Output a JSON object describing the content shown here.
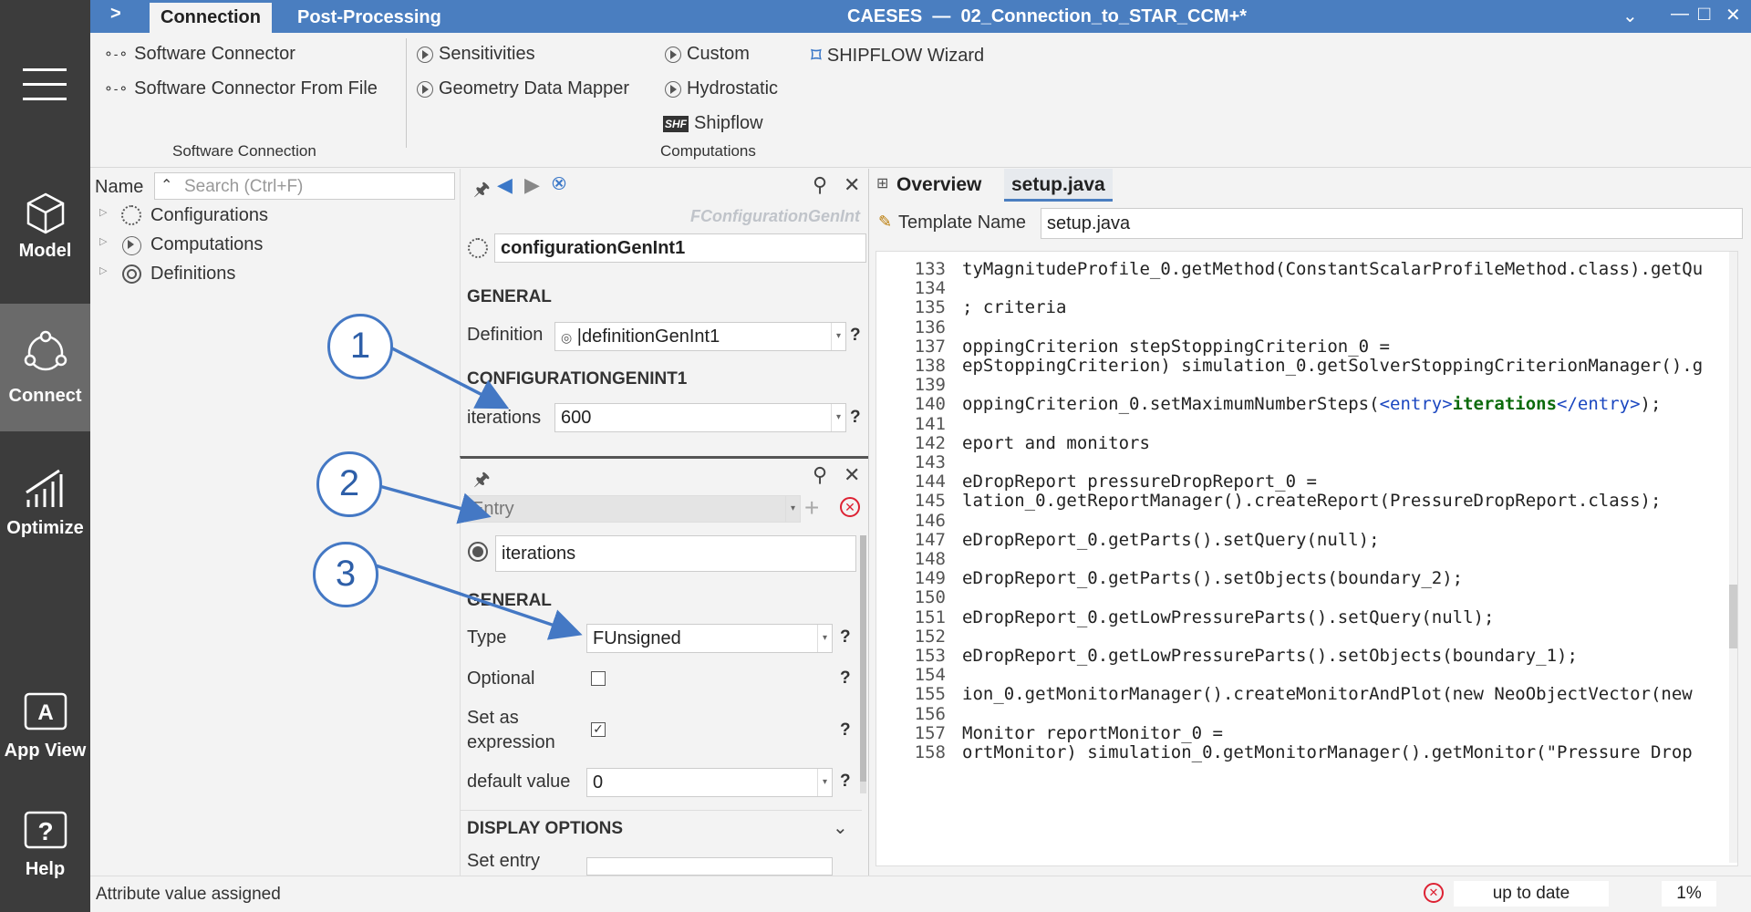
{
  "title_bar": {
    "expand_glyph": ">",
    "tabs": [
      "Connection",
      "Post-Processing"
    ],
    "window_title": "CAESES  —  02_Connection_to_STAR_CCM+*",
    "window_buttons": [
      "⌄",
      "—",
      "□",
      "✕"
    ]
  },
  "left_nav": {
    "items": [
      {
        "label": "Model",
        "icon": "cube-icon"
      },
      {
        "label": "Connect",
        "icon": "connect-icon",
        "active": true
      },
      {
        "label": "Optimize",
        "icon": "chart-bars-icon"
      },
      {
        "label": "App View",
        "icon": "app-view-icon"
      },
      {
        "label": "Help",
        "icon": "help-icon"
      }
    ]
  },
  "ribbon": {
    "software_connection": {
      "items": [
        "Software Connector",
        "Software Connector From File"
      ],
      "group_label": "Software Connection"
    },
    "computations": {
      "col1": [
        "Sensitivities",
        "Geometry Data Mapper"
      ],
      "col2": [
        "Custom",
        "Hydrostatic",
        "Shipflow"
      ],
      "group_label": "Computations",
      "shipflow_icon_text": "SHF"
    },
    "shipflow_wizard": "SHIPFLOW Wizard"
  },
  "tree": {
    "header_name": "Name",
    "search_placeholder": "Search (Ctrl+F)",
    "items": [
      "Configurations",
      "Computations",
      "Definitions"
    ]
  },
  "props": {
    "type_label": "FConfigurationGenInt",
    "object_name": "configurationGenInt1",
    "general_header": "GENERAL",
    "definition_label": "Definition",
    "definition_value": "|definitionGenInt1",
    "config_header": "CONFIGURATIONGENINT1",
    "iterations_label": "iterations",
    "iterations_value": "600",
    "help": "?"
  },
  "entry": {
    "entry_placeholder": "Entry",
    "entry_name": "iterations",
    "general_header": "GENERAL",
    "type_label": "Type",
    "type_value": "FUnsigned",
    "optional_label": "Optional",
    "set_expr_label_1": "Set as",
    "set_expr_label_2": "expression",
    "default_label": "default value",
    "default_value": "0",
    "display_header": "DISPLAY OPTIONS",
    "set_entry_label": "Set entry",
    "help": "?"
  },
  "editor": {
    "tabs": [
      "Overview",
      "setup.java"
    ],
    "template_label": "Template Name",
    "template_value": "setup.java",
    "lines": [
      {
        "n": "133",
        "t": "tyMagnitudeProfile_0.getMethod(ConstantScalarProfileMethod.class).getQu"
      },
      {
        "n": "134",
        "t": ""
      },
      {
        "n": "135",
        "t": "; criteria"
      },
      {
        "n": "136",
        "t": ""
      },
      {
        "n": "137",
        "t": "oppingCriterion stepStoppingCriterion_0 ="
      },
      {
        "n": "138",
        "t": "epStoppingCriterion) simulation_0.getSolverStoppingCriterionManager().g"
      },
      {
        "n": "139",
        "t": ""
      },
      {
        "n": "140",
        "t": "oppingCriterion_0.setMaximumNumberSteps(",
        "tag_open": "<entry>",
        "tag_val": "iterations",
        "tag_close": "</entry>",
        "tail": ");"
      },
      {
        "n": "141",
        "t": ""
      },
      {
        "n": "142",
        "t": "eport and monitors"
      },
      {
        "n": "143",
        "t": ""
      },
      {
        "n": "144",
        "t": "eDropReport pressureDropReport_0 ="
      },
      {
        "n": "145",
        "t": "lation_0.getReportManager().createReport(PressureDropReport.class);"
      },
      {
        "n": "146",
        "t": ""
      },
      {
        "n": "147",
        "t": "eDropReport_0.getParts().setQuery(null);"
      },
      {
        "n": "148",
        "t": ""
      },
      {
        "n": "149",
        "t": "eDropReport_0.getParts().setObjects(boundary_2);"
      },
      {
        "n": "150",
        "t": ""
      },
      {
        "n": "151",
        "t": "eDropReport_0.getLowPressureParts().setQuery(null);"
      },
      {
        "n": "152",
        "t": ""
      },
      {
        "n": "153",
        "t": "eDropReport_0.getLowPressureParts().setObjects(boundary_1);"
      },
      {
        "n": "154",
        "t": ""
      },
      {
        "n": "155",
        "t": "ion_0.getMonitorManager().createMonitorAndPlot(new NeoObjectVector(new"
      },
      {
        "n": "156",
        "t": ""
      },
      {
        "n": "157",
        "t": "Monitor reportMonitor_0 ="
      },
      {
        "n": "158",
        "t": "ortMonitor) simulation_0.getMonitorManager().getMonitor(\"Pressure Drop"
      }
    ]
  },
  "annotations": [
    "1",
    "2",
    "3"
  ],
  "status": {
    "message": "Attribute value assigned",
    "state": "up to date",
    "percent": "1%"
  },
  "colors": {
    "accent": "#4a7ec0",
    "nav": "#3c3c3c",
    "annotation": "#4478c4"
  }
}
